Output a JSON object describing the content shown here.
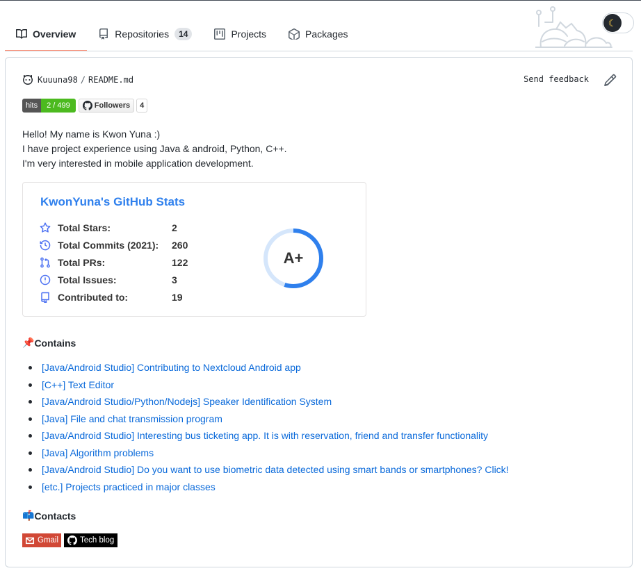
{
  "tabs": [
    {
      "label": "Overview",
      "icon": "book-icon",
      "selected": true
    },
    {
      "label": "Repositories",
      "icon": "repo-icon",
      "count": "14"
    },
    {
      "label": "Projects",
      "icon": "project-icon"
    },
    {
      "label": "Packages",
      "icon": "package-icon"
    }
  ],
  "theme_toggle": {
    "icon": "moon-icon"
  },
  "readme": {
    "user": "Kuuuna98",
    "separator": "/",
    "file": "README.md",
    "send_feedback": "Send feedback",
    "badges": {
      "hits_label": "hits",
      "hits_value": "2 / 499",
      "followers_label": "Followers",
      "followers_count": "4"
    },
    "intro": [
      "Hello! My name is Kwon Yuna :)",
      "I have project experience using Java & android, Python, C++.",
      "I'm very interested in mobile application development."
    ],
    "stats": {
      "title": "KwonYuna's GitHub Stats",
      "rows": [
        {
          "label": "Total Stars:",
          "value": "2",
          "icon": "star-icon"
        },
        {
          "label": "Total Commits (2021):",
          "value": "260",
          "icon": "history-icon"
        },
        {
          "label": "Total PRs:",
          "value": "122",
          "icon": "pull-request-icon"
        },
        {
          "label": "Total Issues:",
          "value": "3",
          "icon": "issue-icon"
        },
        {
          "label": "Contributed to:",
          "value": "19",
          "icon": "repo-icon"
        }
      ],
      "rank": "A+",
      "rank_progress": 0.55,
      "accent": "#2f80ed",
      "icon_color": "#4c71f2"
    },
    "contains": {
      "emoji": "📌",
      "heading": "Contains",
      "items": [
        "[Java/Android Studio] Contributing to Nextcloud Android app",
        "[C++] Text Editor",
        "[Java/Android Studio/Python/Nodejs] Speaker Identification System",
        "[Java] File and chat transmission program",
        "[Java/Android Studio] Interesting bus ticketing app. It is with reservation, friend and transfer functionality",
        "[Java] Algorithm problems",
        "[Java/Android Studio] Do you want to use biometric data detected using smart bands or smartphones? Click!",
        "[etc.] Projects practiced in major classes"
      ]
    },
    "contacts": {
      "emoji": "📫",
      "heading": "Contacts",
      "gmail": "Gmail",
      "blog": "Tech blog"
    }
  },
  "colors": {
    "link": "#0969da",
    "tab_underline": "#fd8c73",
    "hits_green": "#4cba1f",
    "gmail_red": "#d14836"
  }
}
